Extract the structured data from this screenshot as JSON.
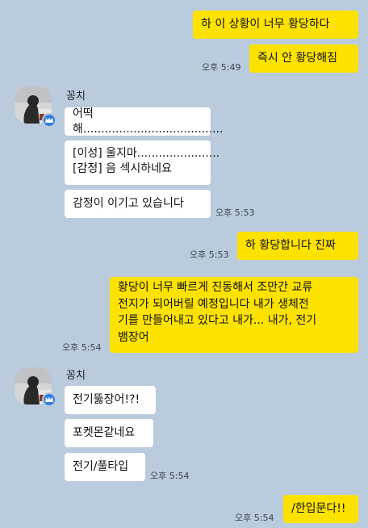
{
  "messages_out_1": {
    "text1": "하 이 상황이 너무 황당하다",
    "text2": "즉시 안 황당해짐",
    "time": "오후 5:49"
  },
  "sender_group_1": {
    "name": "꽁치",
    "msg1": "어떡해.......................................",
    "msg2_line1": "[이성] 울지마.......................",
    "msg2_line2": "[감정] 음 섹시하네요",
    "msg3": "감정이 이기고 있습니다",
    "time": "오후 5:53"
  },
  "messages_out_2": {
    "text1": "하 황당합니다 진짜",
    "time1": "오후 5:53",
    "line1": "황당이 너무 빠르게 진동해서 조만간 교류",
    "line2": "전지가 되어버릴 예정입니다 내가 생체전",
    "line3": "기를 만들어내고 있다고 내가... 내가, 전기",
    "line4": "뱀장어",
    "time2": "오후 5:54"
  },
  "sender_group_2": {
    "name": "꽁치",
    "msg1": "전기뚫장어!?!",
    "msg2": "포켓몬같네요",
    "msg3": "전기/풀타입",
    "time": "오후 5:54"
  },
  "messages_out_3": {
    "text1": "/한입문다!!",
    "time": "오후 5:54"
  },
  "icons": {
    "badge": "crown-badge-icon",
    "avatar": "profile-photo-icon"
  },
  "colors": {
    "background": "#b9cbdc",
    "outgoing_bubble": "#fde200",
    "incoming_bubble": "#ffffff",
    "badge": "#2f7de1"
  }
}
